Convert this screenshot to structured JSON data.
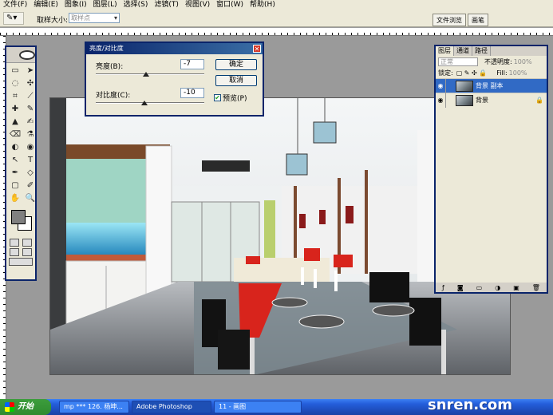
{
  "menu": [
    "文件(F)",
    "编辑(E)",
    "图象(I)",
    "图层(L)",
    "选择(S)",
    "滤镜(T)",
    "视图(V)",
    "窗口(W)",
    "帮助(H)"
  ],
  "options": {
    "tool_glyph": "✎▾",
    "sample_label": "取样大小:",
    "sample_value": "取样点",
    "well_tabs": [
      "文件浏览",
      "画笔"
    ]
  },
  "dialog": {
    "title": "亮度/对比度",
    "brightness_label": "亮度(B):",
    "brightness_value": "-7",
    "brightness_level": -7,
    "contrast_label": "对比度(C):",
    "contrast_value": "-10",
    "contrast_level": -10,
    "ok_label": "确定",
    "cancel_label": "取消",
    "preview_label": "预览(P)",
    "preview_checked": true
  },
  "toolbox": {
    "tools": [
      "▭",
      "➤",
      "◌",
      "✣",
      "⌗",
      "⟋",
      "✚",
      "✎",
      "▲",
      "✍",
      "⌫",
      "⚗",
      "◐",
      "◉",
      "↖",
      "T",
      "✒",
      "◇",
      "▢",
      "✐",
      "✋",
      "🔍"
    ]
  },
  "layers": {
    "tabs": [
      "图层",
      "通道",
      "路径"
    ],
    "blend_mode": "正常",
    "opacity_label": "不透明度:",
    "opacity_value": "100%",
    "lock_label": "锁定:",
    "fill_label": "Fill:",
    "fill_value": "100%",
    "items": [
      {
        "name": "背景 副本",
        "selected": true
      },
      {
        "name": "背景",
        "selected": false
      }
    ]
  },
  "taskbar": {
    "start_label": "开始",
    "tasks": [
      "mp *** 126. 杨坤...",
      "Adobe Photoshop",
      "11 - 画图"
    ]
  },
  "watermark": "snren.com"
}
